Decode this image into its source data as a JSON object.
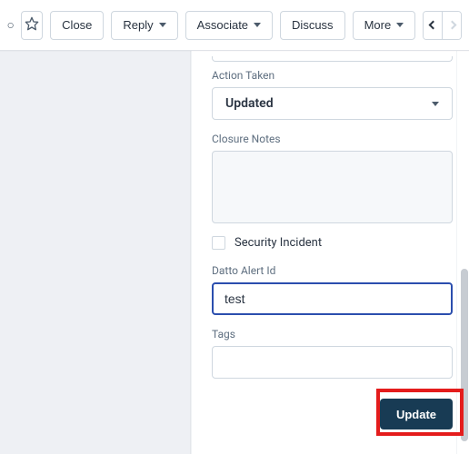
{
  "toolbar": {
    "close": "Close",
    "reply": "Reply",
    "associate": "Associate",
    "discuss": "Discuss",
    "more": "More"
  },
  "form": {
    "action_taken_label": "Action Taken",
    "action_taken_value": "Updated",
    "closure_notes_label": "Closure Notes",
    "closure_notes_value": "",
    "security_incident_label": "Security Incident",
    "datto_alert_id_label": "Datto Alert Id",
    "datto_alert_id_value": "test",
    "tags_label": "Tags",
    "tags_value": "",
    "update_button": "Update"
  },
  "colors": {
    "primary_button_bg": "#183b54",
    "focus_border": "#2b4eae",
    "highlight_border": "#e41c1c"
  }
}
